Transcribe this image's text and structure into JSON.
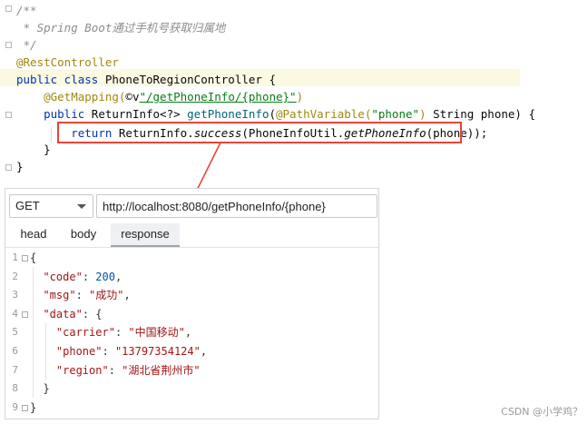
{
  "editor": {
    "lines": [
      {
        "segments": [
          {
            "cls": "comment",
            "text": "/**"
          }
        ]
      },
      {
        "segments": [
          {
            "cls": "comment",
            "text": " * Spring Boot通过手机号获取归属地"
          }
        ]
      },
      {
        "segments": [
          {
            "cls": "comment",
            "text": " */"
          }
        ]
      },
      {
        "segments": [
          {
            "cls": "annot",
            "text": "@RestController"
          }
        ]
      },
      {
        "segments": [
          {
            "cls": "kw",
            "text": "public class "
          },
          {
            "cls": "",
            "text": "PhoneToRegionController {"
          }
        ]
      },
      {
        "segments": [
          {
            "cls": "",
            "text": "    "
          },
          {
            "cls": "annot",
            "text": "@GetMapping("
          },
          {
            "cls": "",
            "text": "©v"
          },
          {
            "cls": "str",
            "text": "\"/getPhoneInfo/{phone}\""
          },
          {
            "cls": "annot",
            "text": ")"
          }
        ]
      },
      {
        "segments": [
          {
            "cls": "",
            "text": "    "
          },
          {
            "cls": "kw",
            "text": "public "
          },
          {
            "cls": "",
            "text": "ReturnInfo<?> "
          },
          {
            "cls": "method",
            "text": "getPhoneInfo"
          },
          {
            "cls": "",
            "text": "("
          },
          {
            "cls": "annot",
            "text": "@PathVariable("
          },
          {
            "cls": "strplain",
            "text": "\"phone\""
          },
          {
            "cls": "annot",
            "text": ")"
          },
          {
            "cls": "",
            "text": " String phone) {"
          }
        ]
      },
      {
        "segments": [
          {
            "cls": "",
            "text": "        "
          },
          {
            "cls": "kw",
            "text": "return "
          },
          {
            "cls": "",
            "text": "ReturnInfo."
          },
          {
            "cls": "italic",
            "text": "success"
          },
          {
            "cls": "",
            "text": "(PhoneInfoUtil."
          },
          {
            "cls": "italic",
            "text": "getPhoneInfo"
          },
          {
            "cls": "",
            "text": "(phone));"
          }
        ]
      },
      {
        "segments": [
          {
            "cls": "",
            "text": "    }"
          }
        ]
      },
      {
        "segments": [
          {
            "cls": "",
            "text": "}"
          }
        ]
      }
    ]
  },
  "request": {
    "method": "GET",
    "url": "http://localhost:8080/getPhoneInfo/{phone}"
  },
  "tabs": [
    {
      "label": "head"
    },
    {
      "label": "body"
    },
    {
      "label": "response"
    }
  ],
  "response": {
    "line_numbers": [
      "1",
      "2",
      "3",
      "4",
      "5",
      "6",
      "7",
      "8",
      "9"
    ],
    "lines": [
      {
        "segments": [
          {
            "cls": "",
            "text": "{"
          }
        ]
      },
      {
        "segments": [
          {
            "cls": "",
            "text": "  "
          },
          {
            "cls": "jkey",
            "text": "\"code\""
          },
          {
            "cls": "",
            "text": ": "
          },
          {
            "cls": "jnum",
            "text": "200"
          },
          {
            "cls": "",
            "text": ","
          }
        ]
      },
      {
        "segments": [
          {
            "cls": "",
            "text": "  "
          },
          {
            "cls": "jkey",
            "text": "\"msg\""
          },
          {
            "cls": "",
            "text": ": "
          },
          {
            "cls": "jstr",
            "text": "\"成功\""
          },
          {
            "cls": "",
            "text": ","
          }
        ]
      },
      {
        "segments": [
          {
            "cls": "",
            "text": "  "
          },
          {
            "cls": "jkey",
            "text": "\"data\""
          },
          {
            "cls": "",
            "text": ": {"
          }
        ]
      },
      {
        "segments": [
          {
            "cls": "",
            "text": "    "
          },
          {
            "cls": "jkey",
            "text": "\"carrier\""
          },
          {
            "cls": "",
            "text": ": "
          },
          {
            "cls": "jstr",
            "text": "\"中国移动\""
          },
          {
            "cls": "",
            "text": ","
          }
        ]
      },
      {
        "segments": [
          {
            "cls": "",
            "text": "    "
          },
          {
            "cls": "jkey",
            "text": "\"phone\""
          },
          {
            "cls": "",
            "text": ": "
          },
          {
            "cls": "jstr",
            "text": "\"13797354124\""
          },
          {
            "cls": "",
            "text": ","
          }
        ]
      },
      {
        "segments": [
          {
            "cls": "",
            "text": "    "
          },
          {
            "cls": "jkey",
            "text": "\"region\""
          },
          {
            "cls": "",
            "text": ": "
          },
          {
            "cls": "jstr",
            "text": "\"湖北省荆州市\""
          }
        ]
      },
      {
        "segments": [
          {
            "cls": "",
            "text": "  }"
          }
        ]
      },
      {
        "segments": [
          {
            "cls": "",
            "text": "}"
          }
        ]
      }
    ]
  },
  "watermark": "CSDN @小学鸡？",
  "colors": {
    "highlight_box": "#e8443a",
    "keyword": "#0033b3",
    "annotation": "#9e880d"
  }
}
